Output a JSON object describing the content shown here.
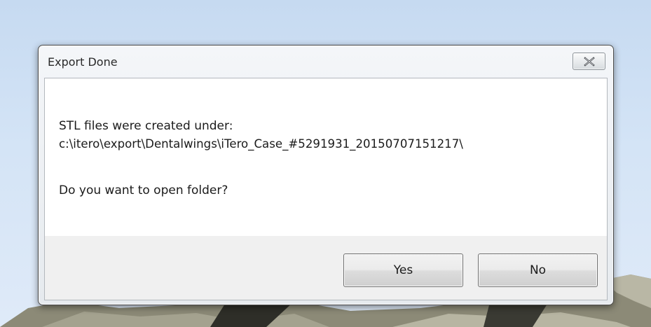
{
  "dialog": {
    "title": "Export Done",
    "close_icon": "close-x-icon",
    "message_line1": "STL files were created under:",
    "message_line2": "c:\\itero\\export\\Dentalwings\\iTero_Case_#5291931_20150707151217\\",
    "question": "Do you want to open folder?",
    "yes_label": "Yes",
    "no_label": "No"
  },
  "colors": {
    "background": "#d4e4f6",
    "model_surface": "#8c8a77",
    "content_bg": "#ffffff",
    "footer_bg": "#f0f0f0"
  }
}
